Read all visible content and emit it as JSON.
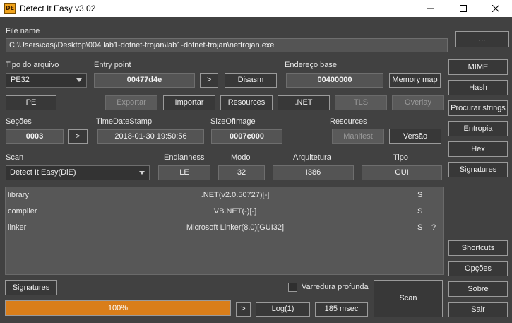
{
  "window": {
    "title": "Detect It Easy v3.02",
    "icon": "die-app-icon"
  },
  "file_name": {
    "label": "File name",
    "value": "C:\\Users\\casj\\Desktop\\004 lab1-dotnet-trojan\\lab1-dotnet-trojan\\nettrojan.exe",
    "browse_label": "..."
  },
  "file_type": {
    "label": "Tipo do arquivo",
    "value": "PE32"
  },
  "entry_point": {
    "label": "Entry point",
    "value": "00477d4e",
    "go_label": ">",
    "disasm_label": "Disasm"
  },
  "base_address": {
    "label": "Endereço base",
    "value": "00400000",
    "memory_map_label": "Memory map"
  },
  "pe_buttons": {
    "pe": "PE",
    "export": "Exportar",
    "import": "Importar",
    "resources": "Resources",
    "net": ".NET",
    "tls": "TLS",
    "overlay": "Overlay"
  },
  "sections": {
    "label": "Seções",
    "value": "0003",
    "go_label": ">"
  },
  "timestamp": {
    "label": "TimeDateStamp",
    "value": "2018-01-30 19:50:56"
  },
  "size_of_image": {
    "label": "SizeOfImage",
    "value": "0007c000"
  },
  "resources_group": {
    "label": "Resources",
    "manifest": "Manifest",
    "version": "Versão"
  },
  "scan": {
    "label": "Scan",
    "engine": "Detect It Easy(DiE)"
  },
  "endianness": {
    "label": "Endianness",
    "value": "LE"
  },
  "mode": {
    "label": "Modo",
    "value": "32"
  },
  "architecture": {
    "label": "Arquitetura",
    "value": "I386"
  },
  "type": {
    "label": "Tipo",
    "value": "GUI"
  },
  "results": [
    {
      "type": "library",
      "name": ".NET(v2.0.50727)[-]",
      "flag": "S",
      "extra": ""
    },
    {
      "type": "compiler",
      "name": "VB.NET(-)[-]",
      "flag": "S",
      "extra": ""
    },
    {
      "type": "linker",
      "name": "Microsoft Linker(8.0)[GUI32]",
      "flag": "S",
      "extra": "?"
    }
  ],
  "side_menu": {
    "mime": "MIME",
    "hash": "Hash",
    "strings": "Procurar strings",
    "entropy": "Entropia",
    "hex": "Hex",
    "signatures": "Signatures"
  },
  "side_bottom": {
    "shortcuts": "Shortcuts",
    "options": "Opções",
    "about": "Sobre",
    "exit": "Sair"
  },
  "bottom": {
    "signatures": "Signatures",
    "deep_scan_label": "Varredura profunda",
    "deep_scan_checked": false,
    "scan": "Scan",
    "progress_text": "100%",
    "progress_value": 1.0,
    "go_label": ">",
    "log": "Log(1)",
    "time": "185 msec"
  },
  "colors": {
    "background": "#414141",
    "progress": "#d97e1a",
    "field": "#545454"
  }
}
